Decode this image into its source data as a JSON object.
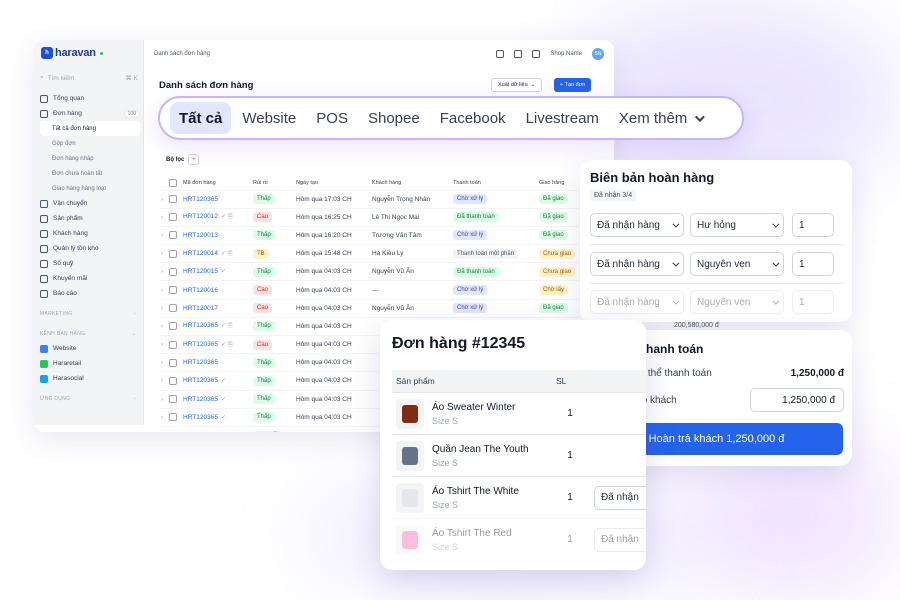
{
  "app": {
    "logo": "haravan",
    "breadcrumb": "Danh sách đơn hàng",
    "shop_name": "Shop Name",
    "avatar_initials": "SN",
    "page_title": "Danh sách đơn hàng",
    "export_label": "Xuất dữ liệu",
    "create_label": "+ Tạo đơn",
    "filter_label": "Bộ lọc",
    "search_placeholder": "Tìm kiếm",
    "search_shortcut": "⌘ K"
  },
  "sidebar": {
    "items": [
      {
        "label": "Tổng quan",
        "icon": "home-icon"
      },
      {
        "label": "Đơn hàng",
        "icon": "cart-icon",
        "count": "100"
      }
    ],
    "order_subitems": [
      "Tất cả đơn hàng",
      "Gộp đơn",
      "Đơn hàng nháp",
      "Đơn chưa hoàn tất",
      "Giao hàng hàng loạt"
    ],
    "items2": [
      {
        "label": "Vận chuyển",
        "icon": "truck-icon"
      },
      {
        "label": "Sản phẩm",
        "icon": "tag-icon"
      },
      {
        "label": "Khách hàng",
        "icon": "users-icon"
      },
      {
        "label": "Quản lý tồn kho",
        "icon": "inventory-icon"
      },
      {
        "label": "Sổ quỹ",
        "icon": "wallet-icon"
      },
      {
        "label": "Khuyến mãi",
        "icon": "promo-icon"
      },
      {
        "label": "Báo cáo",
        "icon": "report-icon"
      }
    ],
    "section_marketing": "MARKETING",
    "section_channels": "KÊNH BÁN HÀNG",
    "channels": [
      {
        "label": "Website",
        "color": "#3b82f6"
      },
      {
        "label": "Hararetail",
        "color": "#22c55e"
      },
      {
        "label": "Harasocial",
        "color": "#0ea5e9"
      }
    ],
    "section_apps": "ỨNG DỤNG"
  },
  "table": {
    "headers": [
      "Mã đơn hàng",
      "Rủi ro",
      "Ngày tạo",
      "Khách hàng",
      "Thanh toán",
      "Giao hàng"
    ],
    "rows": [
      {
        "code": "HRT120365",
        "extra": "",
        "risk": "Thấp",
        "risk_type": "low",
        "time": "Hôm qua 17:03 CH",
        "customer": "Nguyễn Trọng Nhân",
        "pay": "Chờ xử lý",
        "pay_type": "wait",
        "ship": "Đã giao",
        "ship_type": "done"
      },
      {
        "code": "HRT120012",
        "extra": "✓ 🗎",
        "risk": "Cao",
        "risk_type": "high",
        "time": "Hôm qua 16:25 CH",
        "customer": "Lê Thị Ngọc Mai",
        "pay": "Đã thanh toán",
        "pay_type": "done",
        "ship": "Đã giao",
        "ship_type": "done"
      },
      {
        "code": "HRT120013",
        "extra": "",
        "risk": "Thấp",
        "risk_type": "low",
        "time": "Hôm qua 16:20 CH",
        "customer": "Trương Văn Tâm",
        "pay": "Chờ xử lý",
        "pay_type": "wait",
        "ship": "Đã giao",
        "ship_type": "done"
      },
      {
        "code": "HRT120014",
        "extra": "✓ 🗎",
        "risk": "TB",
        "risk_type": "mid",
        "time": "Hôm qua 15:48 CH",
        "customer": "Hà Kiều Ly",
        "pay": "Thanh toán một phần",
        "pay_type": "part",
        "ship": "Chưa giao",
        "ship_type": "not"
      },
      {
        "code": "HRT120015",
        "extra": "✓",
        "risk": "Thấp",
        "risk_type": "low",
        "time": "Hôm qua 04:03 CH",
        "customer": "Nguyễn Vũ Ân",
        "pay": "Đã thanh toán",
        "pay_type": "done",
        "ship": "Chưa giao",
        "ship_type": "not"
      },
      {
        "code": "HRT120016",
        "extra": "",
        "risk": "Cao",
        "risk_type": "high",
        "time": "Hôm qua 04:03 CH",
        "customer": "---",
        "pay": "Chờ xử lý",
        "pay_type": "wait",
        "ship": "Chờ lấy",
        "ship_type": "not"
      },
      {
        "code": "HRT120017",
        "extra": "",
        "risk": "Cao",
        "risk_type": "high",
        "time": "Hôm qua 04:03 CH",
        "customer": "Nguyễn Vũ Ân",
        "pay": "Chờ xử lý",
        "pay_type": "wait",
        "ship": "Đã giao",
        "ship_type": "done"
      },
      {
        "code": "HRT120365",
        "extra": "✓ 🗎",
        "risk": "Thấp",
        "risk_type": "low",
        "time": "Hôm qua 04:03 CH",
        "customer": "",
        "pay": "",
        "pay_type": "",
        "ship": "",
        "ship_type": ""
      },
      {
        "code": "HRT120365",
        "extra": "✓ 🗎",
        "risk": "Cao",
        "risk_type": "high",
        "time": "Hôm qua 04:03 CH",
        "customer": "",
        "pay": "",
        "pay_type": "",
        "ship": "",
        "ship_type": ""
      },
      {
        "code": "HRT120365",
        "extra": "",
        "risk": "Thấp",
        "risk_type": "low",
        "time": "Hôm qua 04:03 CH",
        "customer": "",
        "pay": "",
        "pay_type": "",
        "ship": "",
        "ship_type": ""
      },
      {
        "code": "HRT120365",
        "extra": "✓",
        "risk": "Thấp",
        "risk_type": "low",
        "time": "Hôm qua 04:03 CH",
        "customer": "",
        "pay": "",
        "pay_type": "",
        "ship": "",
        "ship_type": ""
      },
      {
        "code": "HRT120365",
        "extra": "✓",
        "risk": "Thấp",
        "risk_type": "low",
        "time": "Hôm qua 04:03 CH",
        "customer": "",
        "pay": "",
        "pay_type": "",
        "ship": "",
        "ship_type": ""
      },
      {
        "code": "HRT120365",
        "extra": "✓",
        "risk": "Thấp",
        "risk_type": "low",
        "time": "Hôm qua 04:03 CH",
        "customer": "",
        "pay": "",
        "pay_type": "",
        "ship": "",
        "ship_type": ""
      },
      {
        "code": "HRT120365",
        "extra": "✓",
        "risk": "Thấp ⓘ",
        "risk_type": "low",
        "time": "Hôm qua 04:03 CH",
        "customer": "",
        "pay": "",
        "pay_type": "",
        "ship": "",
        "ship_type": ""
      },
      {
        "code": "HRT120365",
        "extra": "",
        "risk": "Thấp ⓘ",
        "risk_type": "low",
        "time": "Hôm qua 04:03 CH",
        "customer": "",
        "pay": "",
        "pay_type": "",
        "ship": "",
        "ship_type": ""
      }
    ]
  },
  "tabs": {
    "items": [
      "Tất cả",
      "Website",
      "POS",
      "Shopee",
      "Facebook",
      "Livestream"
    ],
    "more": "Xem thêm"
  },
  "return_slip": {
    "title": "Biên bản hoàn hàng",
    "badge": "Đã nhận 3/4",
    "rows": [
      {
        "status": "Đã nhận hàng",
        "condition": "Hư hỏng",
        "qty": "1"
      },
      {
        "status": "Đã nhận hàng",
        "condition": "Nguyên vẹn",
        "qty": "1"
      },
      {
        "status": "Đã nhận hàng",
        "condition": "Nguyên vẹn",
        "qty": "1"
      }
    ],
    "under_amount": "200,580,000 đ"
  },
  "refund": {
    "title": "Hoàn trả thanh toán",
    "total_label": "Tổng tiền có thể thanh toán",
    "total_value": "1,250,000 đ",
    "refund_label": "Hoàn trả cho khách",
    "refund_value": "1,250,000 đ",
    "button": "Hoàn trả khách 1,250,000 đ"
  },
  "order": {
    "title": "Đơn hàng #12345",
    "col_product": "Sản phẩm",
    "col_qty": "SL",
    "items": [
      {
        "name": "Áo Sweater Winter",
        "size": "Size S",
        "qty": "1",
        "status": "",
        "color": "#7c2d12"
      },
      {
        "name": "Quần Jean The Youth",
        "size": "Size S",
        "qty": "1",
        "status": "",
        "color": "#64748b"
      },
      {
        "name": "Áo Tshirt The White",
        "size": "Size S",
        "qty": "1",
        "status": "Đã nhận",
        "color": "#e5e7eb"
      },
      {
        "name": "Áo Tshirt The Red",
        "size": "Size S",
        "qty": "1",
        "status": "Đã nhận",
        "color": "#f472b6"
      }
    ]
  }
}
